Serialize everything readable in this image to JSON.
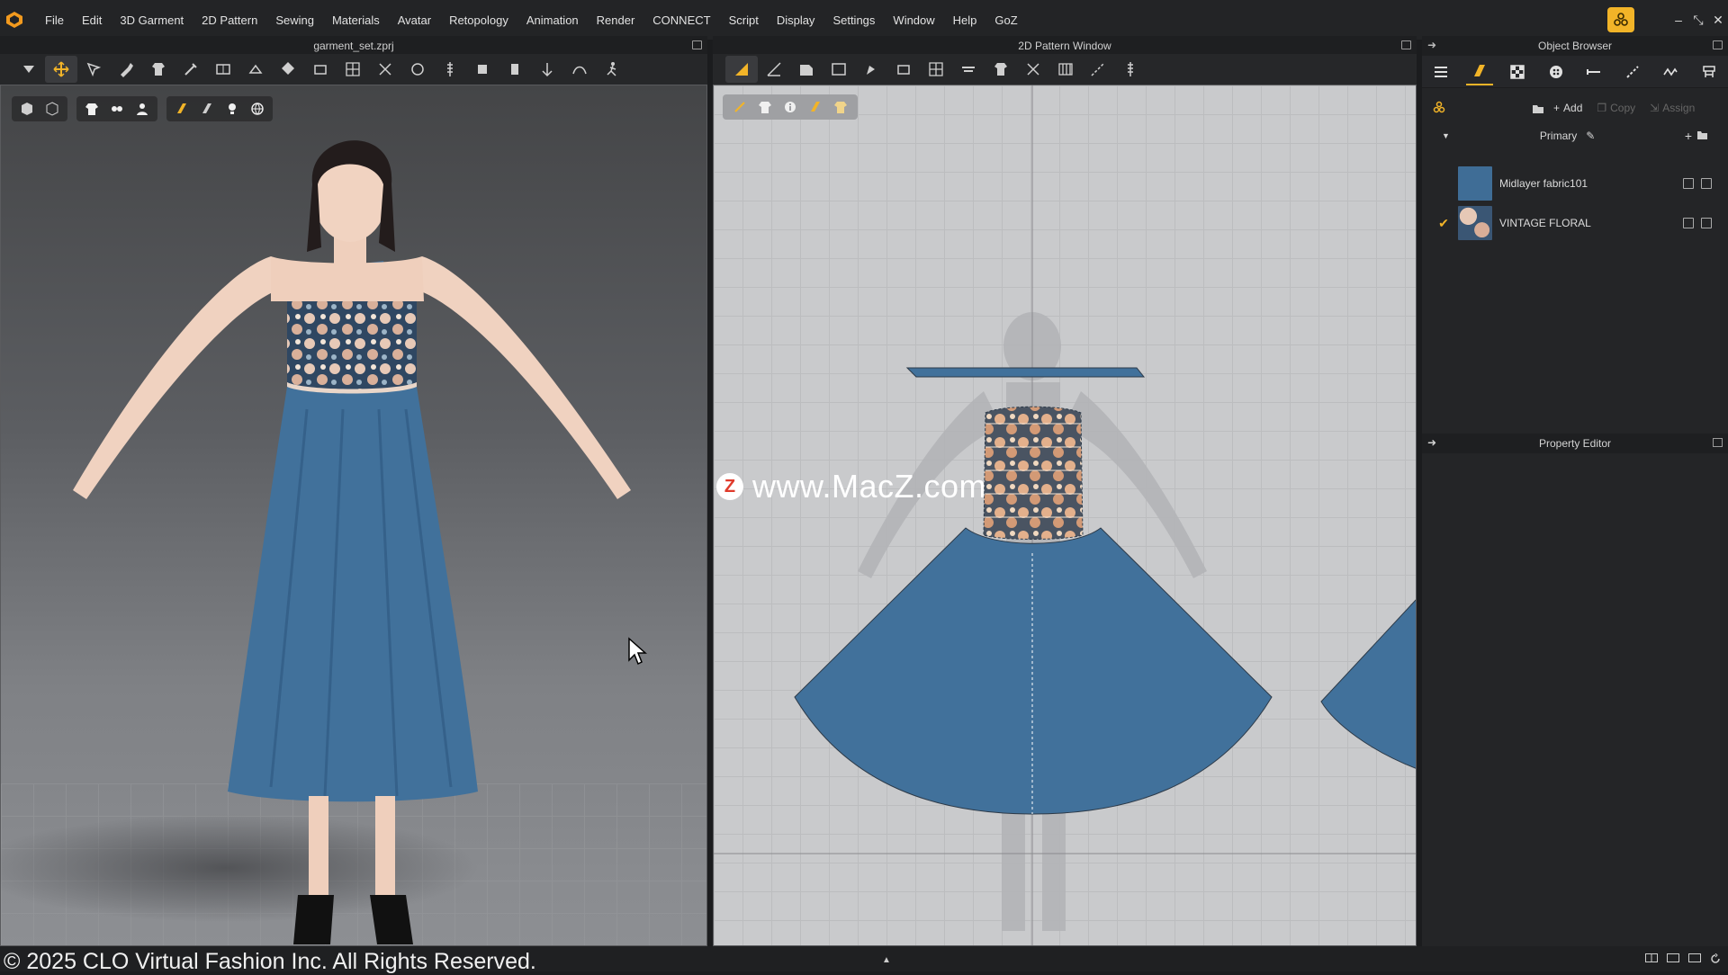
{
  "menubar": {
    "items": [
      "File",
      "Edit",
      "3D Garment",
      "2D Pattern",
      "Sewing",
      "Materials",
      "Avatar",
      "Retopology",
      "Animation",
      "Render",
      "CONNECT",
      "Script",
      "Display",
      "Settings",
      "Window",
      "Help",
      "GoZ"
    ],
    "window_controls": [
      "–",
      "⤡",
      "✕"
    ]
  },
  "viewport3d": {
    "title": "garment_set.zprj"
  },
  "pattern2d": {
    "title": "2D Pattern Window"
  },
  "object_browser": {
    "title": "Object Browser",
    "actions": {
      "add": "Add",
      "copy": "Copy",
      "assign": "Assign"
    },
    "group": "Primary",
    "fabrics": [
      {
        "name": "Midlayer fabric101",
        "color": "#3f6d96",
        "checked": false
      },
      {
        "name": "VINTAGE FLORAL",
        "color": "#6c7f97",
        "checked": true
      }
    ]
  },
  "property_editor": {
    "title": "Property Editor"
  },
  "status": {
    "copyright": "© 2025 CLO Virtual Fashion Inc. All Rights Reserved.",
    "center": "▲"
  },
  "watermark": {
    "logo": "Z",
    "text": "www.MacZ.com"
  },
  "colors": {
    "accent": "#f2b428",
    "fabric_blue": "#41719b"
  }
}
